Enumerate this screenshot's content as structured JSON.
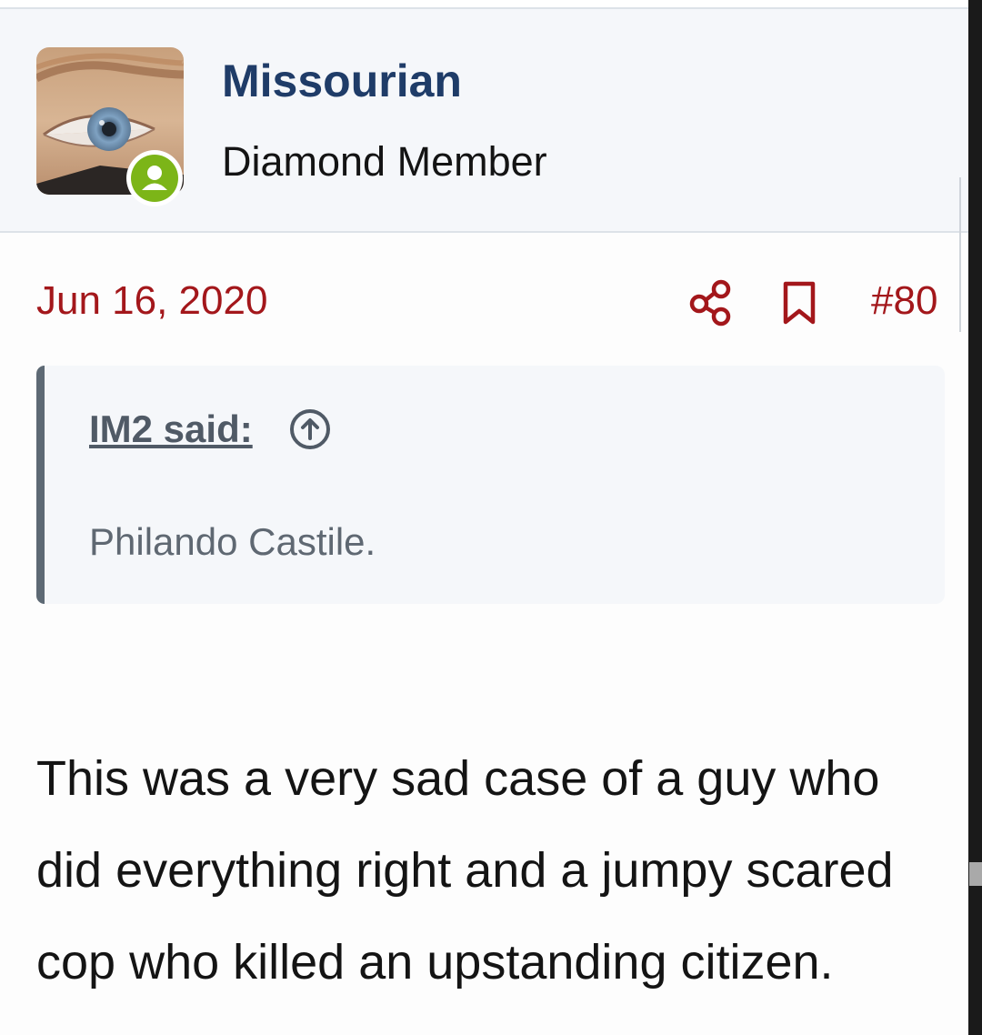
{
  "user": {
    "name": "Missourian",
    "title": "Diamond Member"
  },
  "post": {
    "date": "Jun 16, 2020",
    "number": "#80",
    "body": "This was a very sad case of a guy who did everything right and a jumpy scared cop who killed an upstanding citizen."
  },
  "quote": {
    "attribution": "IM2 said:",
    "text": "Philando Castile."
  },
  "icons": {
    "share": "share-icon",
    "bookmark": "bookmark-icon",
    "jump": "arrow-up-circle-icon",
    "online": "online-status-icon"
  },
  "colors": {
    "username": "#1f3c68",
    "accent": "#a3171b",
    "online": "#7cb518",
    "quote_bar": "#5d6974"
  }
}
